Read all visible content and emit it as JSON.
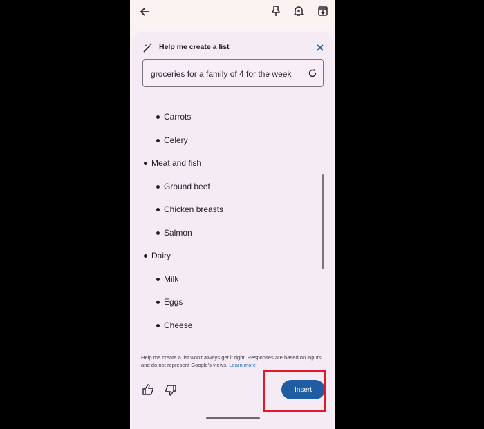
{
  "toolbar": {
    "back_icon": "arrow-left-icon",
    "pin_icon": "pin-icon",
    "reminder_icon": "bell-plus-icon",
    "archive_icon": "archive-icon"
  },
  "panel": {
    "title": "Help me create a list",
    "title_icon": "magic-wand-icon",
    "close_icon": "close-icon",
    "prompt": "groceries for a family of 4 for the week",
    "refresh_icon": "refresh-icon"
  },
  "list": {
    "items": [
      {
        "text": "Carrots",
        "level": 2
      },
      {
        "text": "Celery",
        "level": 2
      },
      {
        "text": "Meat and fish",
        "level": 1
      },
      {
        "text": "Ground beef",
        "level": 2
      },
      {
        "text": "Chicken breasts",
        "level": 2
      },
      {
        "text": "Salmon",
        "level": 2
      },
      {
        "text": "Dairy",
        "level": 1
      },
      {
        "text": "Milk",
        "level": 2
      },
      {
        "text": "Eggs",
        "level": 2
      },
      {
        "text": "Cheese",
        "level": 2
      }
    ]
  },
  "footer": {
    "disclaimer": "Help me create a list won't always get it right. Responses are based on inputs and do not represent Google's views.",
    "learn_more": "Learn more",
    "thumbs_up_icon": "thumbs-up-icon",
    "thumbs_down_icon": "thumbs-down-icon",
    "insert_label": "Insert"
  },
  "colors": {
    "accent": "#1e5da2",
    "sheet_bg": "#f5ebf5",
    "highlight": "#e3182d"
  }
}
